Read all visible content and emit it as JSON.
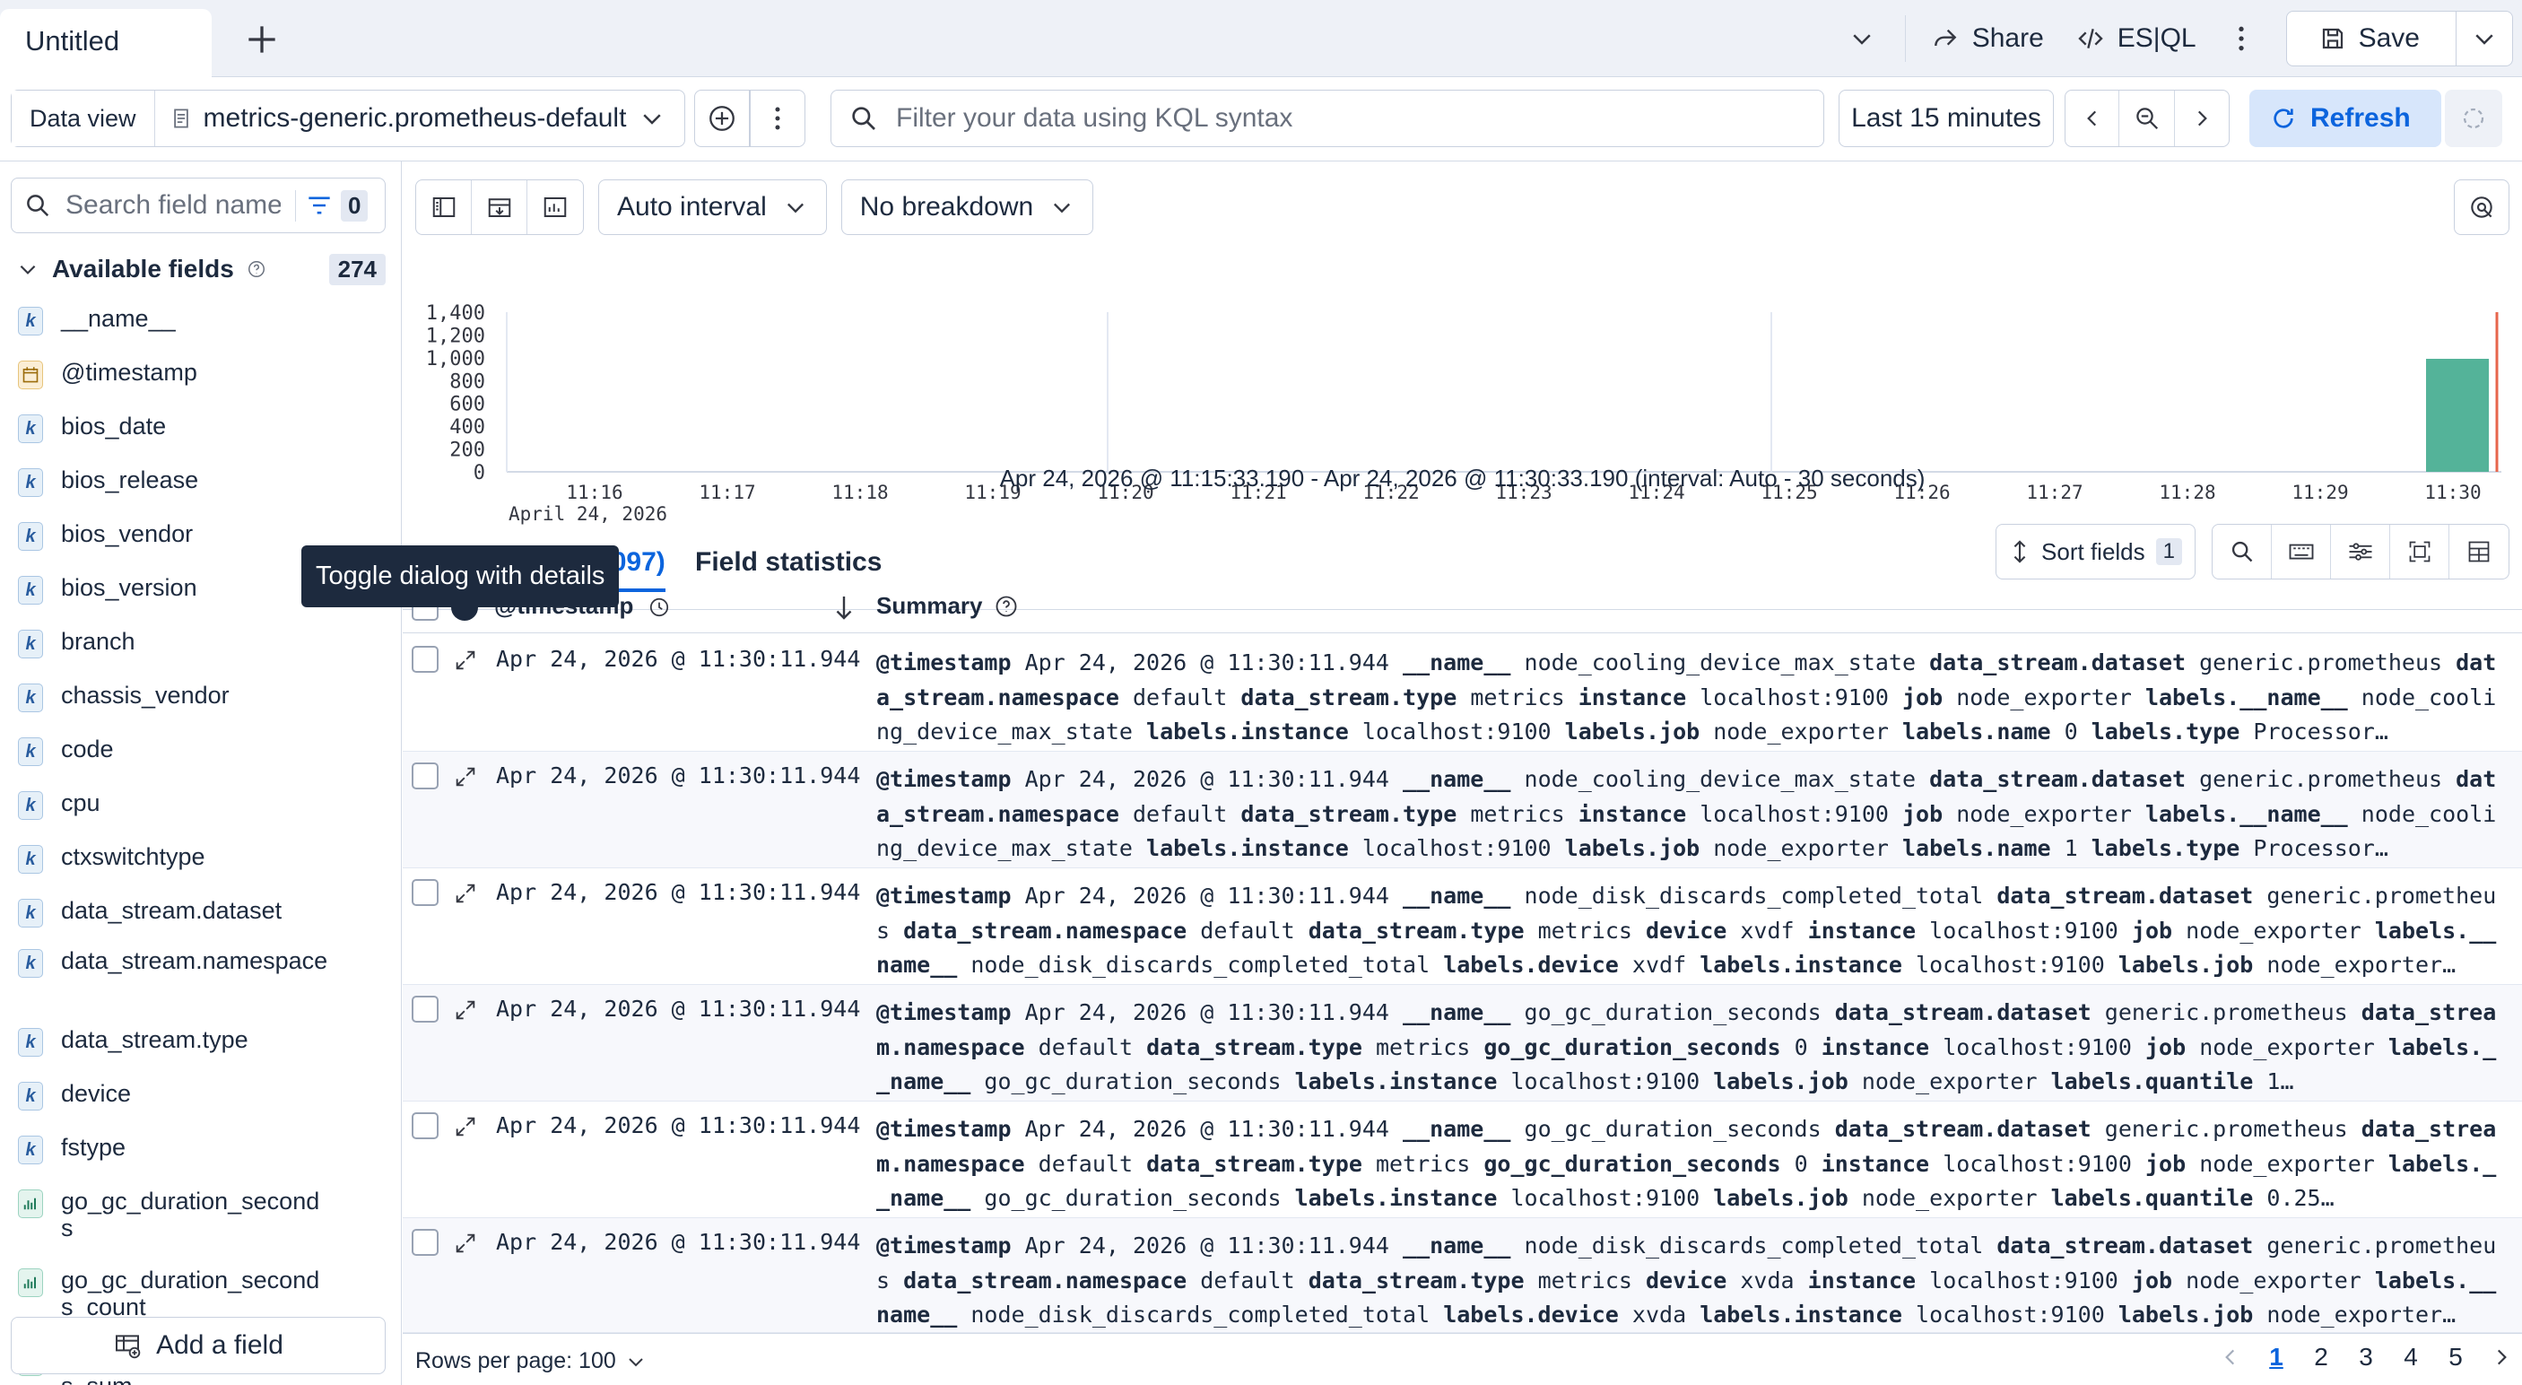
{
  "tab": {
    "title": "Untitled",
    "add_icon": "plus-icon"
  },
  "top_actions": {
    "share": "Share",
    "esql": "ES|QL",
    "save": "Save"
  },
  "query": {
    "data_view_label": "Data view",
    "data_view_value": "metrics-generic.prometheus-default",
    "kql_placeholder": "Filter your data using KQL syntax",
    "time_range": "Last 15 minutes",
    "refresh": "Refresh"
  },
  "sidebar": {
    "search_placeholder": "Search field names",
    "filter_count": "0",
    "available_label": "Available fields",
    "available_count": "274",
    "fields": [
      {
        "name": "__name__",
        "type": "k"
      },
      {
        "name": "@timestamp",
        "type": "date"
      },
      {
        "name": "bios_date",
        "type": "k"
      },
      {
        "name": "bios_release",
        "type": "k"
      },
      {
        "name": "bios_vendor",
        "type": "k"
      },
      {
        "name": "bios_version",
        "type": "k"
      },
      {
        "name": "branch",
        "type": "k"
      },
      {
        "name": "chassis_vendor",
        "type": "k"
      },
      {
        "name": "code",
        "type": "k"
      },
      {
        "name": "cpu",
        "type": "k"
      },
      {
        "name": "ctxswitchtype",
        "type": "k"
      },
      {
        "name": "data_stream.dataset",
        "type": "k"
      },
      {
        "name": "data_stream.namespace",
        "type": "k"
      },
      {
        "name": "data_stream.type",
        "type": "k"
      },
      {
        "name": "device",
        "type": "k"
      },
      {
        "name": "fstype",
        "type": "k"
      },
      {
        "name": "go_gc_duration_seconds",
        "type": "num"
      },
      {
        "name": "go_gc_duration_seconds_count",
        "type": "num"
      },
      {
        "name": "go_gc_duration_seconds_sum",
        "type": "num"
      }
    ],
    "add_field": "Add a field"
  },
  "toolbar": {
    "interval": "Auto interval",
    "breakdown": "No breakdown"
  },
  "histogram": {
    "y_ticks": [
      "1,400",
      "1,200",
      "1,000",
      "800",
      "600",
      "400",
      "200",
      "0"
    ],
    "x_ticks": [
      "11:16",
      "11:17",
      "11:18",
      "11:19",
      "11:20",
      "11:21",
      "11:22",
      "11:23",
      "11:24",
      "11:25",
      "11:26",
      "11:27",
      "11:28",
      "11:29",
      "11:30"
    ],
    "date_label": "April 24, 2026",
    "range_text": "Apr 24, 2026 @ 11:15:33.190 - Apr 24, 2026 @ 11:30:33.190 (interval: Auto - 30 seconds)",
    "bar_color": "#54b399"
  },
  "tabs": {
    "documents": "Documents (1,097)",
    "field_stats": "Field statistics"
  },
  "table": {
    "sort_fields": "Sort fields",
    "sort_count": "1",
    "col_time": "@timestamp",
    "col_summary": "Summary",
    "rows": [
      {
        "timestamp": "Apr 24, 2026 @ 11:30:11.944",
        "pairs": [
          [
            "@timestamp",
            "Apr 24, 2026 @ 11:30:11.944"
          ],
          [
            "__name__",
            "node_cooling_device_max_state"
          ],
          [
            "data_stream.dataset",
            "generic.prometheus"
          ],
          [
            "data_stream.namespace",
            "default"
          ],
          [
            "data_stream.type",
            "metrics"
          ],
          [
            "instance",
            "localhost:9100"
          ],
          [
            "job",
            "node_exporter"
          ],
          [
            "labels.__name__",
            "node_cooling_device_max_state"
          ],
          [
            "labels.instance",
            "localhost:9100"
          ],
          [
            "labels.job",
            "node_exporter"
          ],
          [
            "labels.name",
            "0"
          ],
          [
            "labels.type",
            "Processor…"
          ]
        ]
      },
      {
        "timestamp": "Apr 24, 2026 @ 11:30:11.944",
        "pairs": [
          [
            "@timestamp",
            "Apr 24, 2026 @ 11:30:11.944"
          ],
          [
            "__name__",
            "node_cooling_device_max_state"
          ],
          [
            "data_stream.dataset",
            "generic.prometheus"
          ],
          [
            "data_stream.namespace",
            "default"
          ],
          [
            "data_stream.type",
            "metrics"
          ],
          [
            "instance",
            "localhost:9100"
          ],
          [
            "job",
            "node_exporter"
          ],
          [
            "labels.__name__",
            "node_cooling_device_max_state"
          ],
          [
            "labels.instance",
            "localhost:9100"
          ],
          [
            "labels.job",
            "node_exporter"
          ],
          [
            "labels.name",
            "1"
          ],
          [
            "labels.type",
            "Processor…"
          ]
        ]
      },
      {
        "timestamp": "Apr 24, 2026 @ 11:30:11.944",
        "pairs": [
          [
            "@timestamp",
            "Apr 24, 2026 @ 11:30:11.944"
          ],
          [
            "__name__",
            "node_disk_discards_completed_total"
          ],
          [
            "data_stream.dataset",
            "generic.prometheus"
          ],
          [
            "data_stream.namespace",
            "default"
          ],
          [
            "data_stream.type",
            "metrics"
          ],
          [
            "device",
            "xvdf"
          ],
          [
            "instance",
            "localhost:9100"
          ],
          [
            "job",
            "node_exporter"
          ],
          [
            "labels.__name__",
            "node_disk_discards_completed_total"
          ],
          [
            "labels.device",
            "xvdf"
          ],
          [
            "labels.instance",
            "localhost:9100"
          ],
          [
            "labels.job",
            "node_exporter…"
          ]
        ]
      },
      {
        "timestamp": "Apr 24, 2026 @ 11:30:11.944",
        "pairs": [
          [
            "@timestamp",
            "Apr 24, 2026 @ 11:30:11.944"
          ],
          [
            "__name__",
            "go_gc_duration_seconds"
          ],
          [
            "data_stream.dataset",
            "generic.prometheus"
          ],
          [
            "data_stream.namespace",
            "default"
          ],
          [
            "data_stream.type",
            "metrics"
          ],
          [
            "go_gc_duration_seconds",
            "0"
          ],
          [
            "instance",
            "localhost:9100"
          ],
          [
            "job",
            "node_exporter"
          ],
          [
            "labels.__name__",
            "go_gc_duration_seconds"
          ],
          [
            "labels.instance",
            "localhost:9100"
          ],
          [
            "labels.job",
            "node_exporter"
          ],
          [
            "labels.quantile",
            "1…"
          ]
        ]
      },
      {
        "timestamp": "Apr 24, 2026 @ 11:30:11.944",
        "pairs": [
          [
            "@timestamp",
            "Apr 24, 2026 @ 11:30:11.944"
          ],
          [
            "__name__",
            "go_gc_duration_seconds"
          ],
          [
            "data_stream.dataset",
            "generic.prometheus"
          ],
          [
            "data_stream.namespace",
            "default"
          ],
          [
            "data_stream.type",
            "metrics"
          ],
          [
            "go_gc_duration_seconds",
            "0"
          ],
          [
            "instance",
            "localhost:9100"
          ],
          [
            "job",
            "node_exporter"
          ],
          [
            "labels.__name__",
            "go_gc_duration_seconds"
          ],
          [
            "labels.instance",
            "localhost:9100"
          ],
          [
            "labels.job",
            "node_exporter"
          ],
          [
            "labels.quantile",
            "0.25…"
          ]
        ]
      },
      {
        "timestamp": "Apr 24, 2026 @ 11:30:11.944",
        "pairs": [
          [
            "@timestamp",
            "Apr 24, 2026 @ 11:30:11.944"
          ],
          [
            "__name__",
            "node_disk_discards_completed_total"
          ],
          [
            "data_stream.dataset",
            "generic.prometheus"
          ],
          [
            "data_stream.namespace",
            "default"
          ],
          [
            "data_stream.type",
            "metrics"
          ],
          [
            "device",
            "xvda"
          ],
          [
            "instance",
            "localhost:9100"
          ],
          [
            "job",
            "node_exporter"
          ],
          [
            "labels.__name__",
            "node_disk_discards_completed_total"
          ],
          [
            "labels.device",
            "xvda"
          ],
          [
            "labels.instance",
            "localhost:9100"
          ],
          [
            "labels.job",
            "node_exporter…"
          ]
        ]
      }
    ]
  },
  "footer": {
    "rows_per_page": "Rows per page: 100",
    "pages": [
      "1",
      "2",
      "3",
      "4",
      "5"
    ],
    "active_page": "1"
  },
  "tooltip": "Toggle dialog with details"
}
